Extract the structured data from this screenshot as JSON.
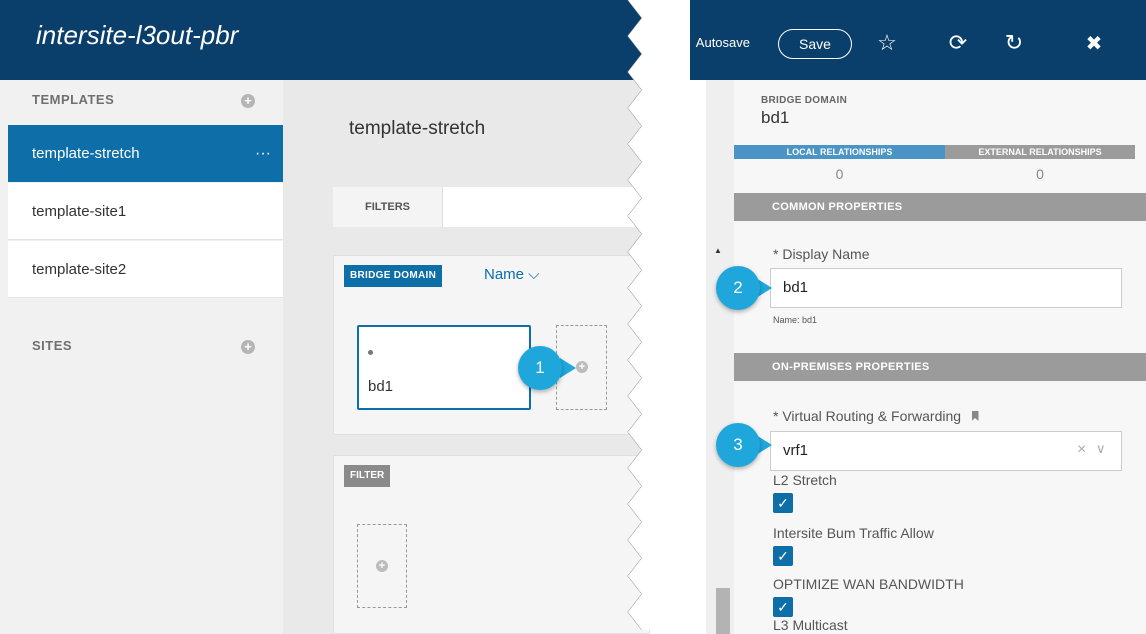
{
  "app": {
    "title": "intersite-l3out-pbr"
  },
  "sidebar": {
    "templates_heading": "TEMPLATES",
    "templates": [
      {
        "label": "template-stretch",
        "active": true,
        "more": "···"
      },
      {
        "label": "template-site1"
      },
      {
        "label": "template-site2"
      }
    ],
    "sites_heading": "SITES"
  },
  "main": {
    "template_name": "template-stretch",
    "filters_label": "FILTERS",
    "bridge_domain_tag": "BRIDGE DOMAIN",
    "sort_label": "Name ⌵",
    "bd_item_label": "bd1",
    "filter_tag": "FILTER"
  },
  "callouts": {
    "one": "1",
    "two": "2",
    "three": "3"
  },
  "toolbar": {
    "autosave_label": "Autosave",
    "save_label": "Save"
  },
  "icons": {
    "favorite": "☆",
    "history": "⟳",
    "refresh": "↻",
    "close": "✖"
  },
  "details": {
    "section_label": "BRIDGE DOMAIN",
    "title": "bd1",
    "tabs": [
      {
        "label": "LOCAL RELATIONSHIPS",
        "count": "0"
      },
      {
        "label": "EXTERNAL RELATIONSHIPS",
        "count": "0"
      }
    ],
    "common_properties": "COMMON PROPERTIES",
    "display_name_label": "* Display Name",
    "display_name_value": "bd1",
    "name_hint": "Name: bd1",
    "on_premises_properties": "ON-PREMISES PROPERTIES",
    "vrf_label": "* Virtual Routing & Forwarding",
    "vrf_value": "vrf1",
    "checkboxes": [
      {
        "label": "L2 Stretch",
        "checked": true
      },
      {
        "label": "Intersite Bum Traffic Allow",
        "checked": true
      },
      {
        "label": "OPTIMIZE WAN BANDWIDTH",
        "checked": true
      },
      {
        "label": "L3 Multicast"
      }
    ]
  },
  "colors": {
    "header": "#0b3f6b",
    "accent": "#0d6ea8",
    "callout": "#1fa7dc"
  }
}
